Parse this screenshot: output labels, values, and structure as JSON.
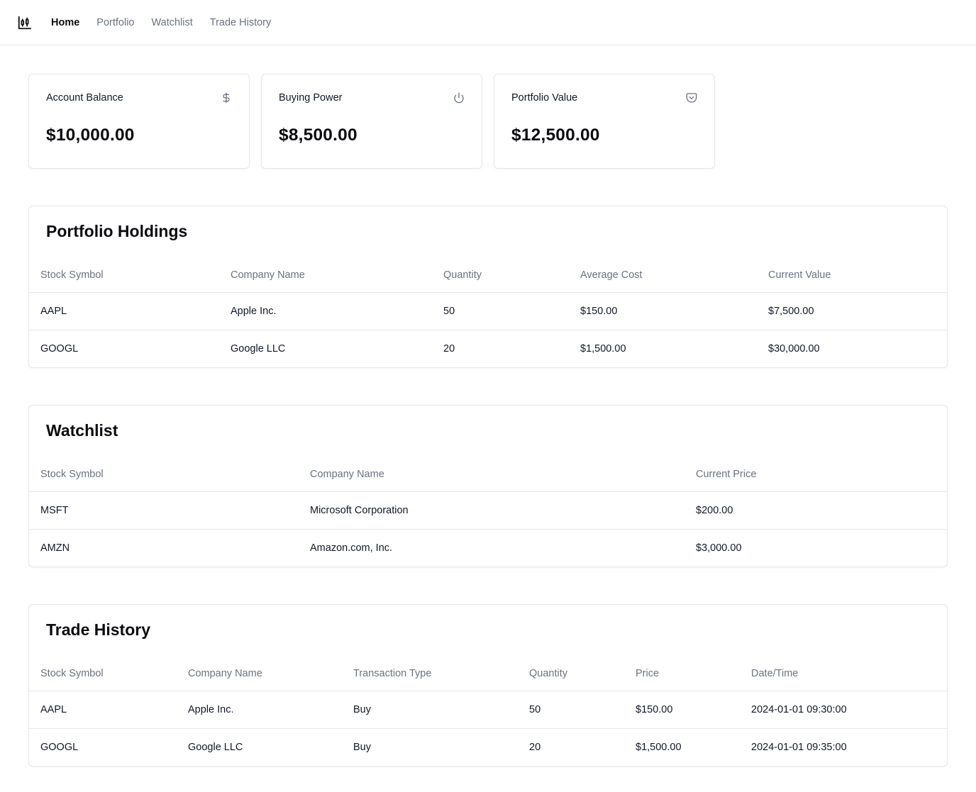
{
  "nav": {
    "items": [
      {
        "label": "Home",
        "active": true
      },
      {
        "label": "Portfolio",
        "active": false
      },
      {
        "label": "Watchlist",
        "active": false
      },
      {
        "label": "Trade History",
        "active": false
      }
    ]
  },
  "stats": [
    {
      "label": "Account Balance",
      "value": "$10,000.00",
      "icon": "dollar-icon"
    },
    {
      "label": "Buying Power",
      "value": "$8,500.00",
      "icon": "power-icon"
    },
    {
      "label": "Portfolio Value",
      "value": "$12,500.00",
      "icon": "pocket-icon"
    }
  ],
  "holdings": {
    "title": "Portfolio Holdings",
    "columns": [
      "Stock Symbol",
      "Company Name",
      "Quantity",
      "Average Cost",
      "Current Value"
    ],
    "rows": [
      [
        "AAPL",
        "Apple Inc.",
        "50",
        "$150.00",
        "$7,500.00"
      ],
      [
        "GOOGL",
        "Google LLC",
        "20",
        "$1,500.00",
        "$30,000.00"
      ]
    ]
  },
  "watchlist": {
    "title": "Watchlist",
    "columns": [
      "Stock Symbol",
      "Company Name",
      "Current Price"
    ],
    "rows": [
      [
        "MSFT",
        "Microsoft Corporation",
        "$200.00"
      ],
      [
        "AMZN",
        "Amazon.com, Inc.",
        "$3,000.00"
      ]
    ]
  },
  "trades": {
    "title": "Trade History",
    "columns": [
      "Stock Symbol",
      "Company Name",
      "Transaction Type",
      "Quantity",
      "Price",
      "Date/Time"
    ],
    "rows": [
      [
        "AAPL",
        "Apple Inc.",
        "Buy",
        "50",
        "$150.00",
        "2024-01-01 09:30:00"
      ],
      [
        "GOOGL",
        "Google LLC",
        "Buy",
        "20",
        "$1,500.00",
        "2024-01-01 09:35:00"
      ]
    ]
  }
}
